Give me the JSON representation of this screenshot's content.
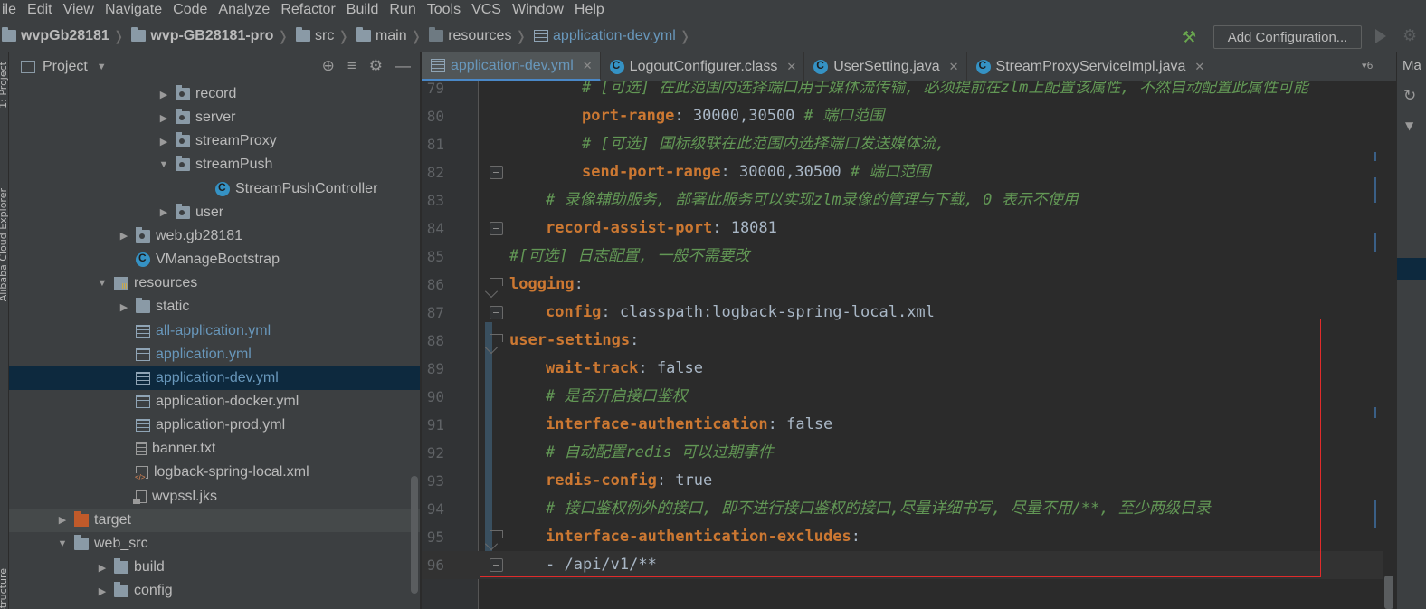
{
  "menu": [
    "ile",
    "Edit",
    "View",
    "Navigate",
    "Code",
    "Analyze",
    "Refactor",
    "Build",
    "Run",
    "Tools",
    "VCS",
    "Window",
    "Help"
  ],
  "breadcrumb": {
    "items": [
      {
        "label": "wvpGb28181",
        "bold": true,
        "icon": "folder-icon"
      },
      {
        "label": "wvp-GB28181-pro",
        "bold": true,
        "icon": "folder-icon"
      },
      {
        "label": "src",
        "bold": false,
        "icon": "folder-icon"
      },
      {
        "label": "main",
        "bold": false,
        "icon": "folder-icon"
      },
      {
        "label": "resources",
        "bold": false,
        "icon": "resources-folder-icon"
      },
      {
        "label": "application-dev.yml",
        "bold": false,
        "icon": "yml-file-icon"
      }
    ]
  },
  "toolbar": {
    "add_configuration_label": "Add Configuration...",
    "build_icon": "hammer-icon",
    "run_icon": "run-icon",
    "settings_icon": "gear-icon"
  },
  "left_stripe": {
    "tab_project": "1: Project",
    "tab_cloud": "Alibaba Cloud Explorer",
    "tab_structure": "Structure"
  },
  "project_panel": {
    "title": "Project",
    "tree": [
      {
        "label": "record",
        "depth": 3,
        "arrow": "right",
        "icon": "package-icon",
        "style": "plain"
      },
      {
        "label": "server",
        "depth": 3,
        "arrow": "right",
        "icon": "package-icon",
        "style": "plain"
      },
      {
        "label": "streamProxy",
        "depth": 3,
        "arrow": "right",
        "icon": "package-icon",
        "style": "plain"
      },
      {
        "label": "streamPush",
        "depth": 3,
        "arrow": "down",
        "icon": "package-icon",
        "style": "plain"
      },
      {
        "label": "StreamPushController",
        "depth": 4,
        "arrow": "",
        "icon": "class-icon",
        "style": "plain"
      },
      {
        "label": "user",
        "depth": 3,
        "arrow": "right",
        "icon": "package-icon",
        "style": "plain"
      },
      {
        "label": "web.gb28181",
        "depth": 2,
        "arrow": "right",
        "icon": "package-icon",
        "style": "plain"
      },
      {
        "label": "VManageBootstrap",
        "depth": 2,
        "arrow": "",
        "icon": "spring-boot-class-icon",
        "style": "plain"
      },
      {
        "label": "resources",
        "depth": 1,
        "arrow": "down",
        "icon": "resources-folder-icon",
        "style": "plain"
      },
      {
        "label": "static",
        "depth": 2,
        "arrow": "right",
        "icon": "folder-icon",
        "style": "plain"
      },
      {
        "label": "all-application.yml",
        "depth": 2,
        "arrow": "",
        "icon": "yml-file-icon",
        "style": "blue"
      },
      {
        "label": "application.yml",
        "depth": 2,
        "arrow": "",
        "icon": "yml-file-icon",
        "style": "blue"
      },
      {
        "label": "application-dev.yml",
        "depth": 2,
        "arrow": "",
        "icon": "yml-file-icon",
        "style": "blue",
        "selected": true
      },
      {
        "label": "application-docker.yml",
        "depth": 2,
        "arrow": "",
        "icon": "yml-file-icon",
        "style": "plain"
      },
      {
        "label": "application-prod.yml",
        "depth": 2,
        "arrow": "",
        "icon": "yml-file-icon",
        "style": "plain"
      },
      {
        "label": "banner.txt",
        "depth": 2,
        "arrow": "",
        "icon": "text-file-icon",
        "style": "plain"
      },
      {
        "label": "logback-spring-local.xml",
        "depth": 2,
        "arrow": "",
        "icon": "xml-file-icon",
        "style": "plain"
      },
      {
        "label": "wvpssl.jks",
        "depth": 2,
        "arrow": "",
        "icon": "keystore-file-icon",
        "style": "plain"
      },
      {
        "label": "target",
        "depth": 0,
        "arrow": "right",
        "icon": "target-folder-icon",
        "style": "plain",
        "hover": true
      },
      {
        "label": "web_src",
        "depth": 0,
        "arrow": "down",
        "icon": "folder-icon",
        "style": "plain"
      },
      {
        "label": "build",
        "depth": 1,
        "arrow": "right",
        "icon": "folder-icon",
        "style": "plain"
      },
      {
        "label": "config",
        "depth": 1,
        "arrow": "right",
        "icon": "folder-icon",
        "style": "plain"
      }
    ]
  },
  "tabs": [
    {
      "label": "application-dev.yml",
      "icon": "yml-file-icon",
      "active": true
    },
    {
      "label": "LogoutConfigurer.class",
      "icon": "class-file-icon",
      "active": false
    },
    {
      "label": "UserSetting.java",
      "icon": "class-icon",
      "active": false
    },
    {
      "label": "StreamProxyServiceImpl.java",
      "icon": "class-icon",
      "active": false
    }
  ],
  "tab_overflow_count": "6",
  "editor": {
    "lines": [
      {
        "n": "79",
        "indent": 4,
        "parts": [
          {
            "t": "# [可选] 在此范围内选择端口用于媒体流传输, 必须提前在zlm上配置该属性, 不然自动配置此属性可能",
            "c": "c"
          }
        ]
      },
      {
        "n": "80",
        "indent": 4,
        "parts": [
          {
            "t": "port-range",
            "c": "k"
          },
          {
            "t": ": 30000,30500 ",
            "c": "v"
          },
          {
            "t": "# 端口范围",
            "c": "c"
          }
        ]
      },
      {
        "n": "81",
        "indent": 4,
        "parts": [
          {
            "t": "# [可选] 国标级联在此范围内选择端口发送媒体流,",
            "c": "c"
          }
        ]
      },
      {
        "n": "82",
        "indent": 4,
        "parts": [
          {
            "t": "send-port-range",
            "c": "k"
          },
          {
            "t": ": 30000,30500 ",
            "c": "v"
          },
          {
            "t": "# 端口范围",
            "c": "c"
          }
        ],
        "fold": "end"
      },
      {
        "n": "83",
        "indent": 2,
        "parts": [
          {
            "t": "# 录像辅助服务, 部署此服务可以实现zlm录像的管理与下载, 0 表示不使用",
            "c": "c"
          }
        ]
      },
      {
        "n": "84",
        "indent": 2,
        "parts": [
          {
            "t": "record-assist-port",
            "c": "k"
          },
          {
            "t": ": 18081",
            "c": "v"
          }
        ],
        "fold": "end"
      },
      {
        "n": "85",
        "indent": 0,
        "parts": [
          {
            "t": "#[可选] 日志配置, 一般不需要改",
            "c": "c"
          }
        ]
      },
      {
        "n": "86",
        "indent": 0,
        "parts": [
          {
            "t": "logging",
            "c": "k"
          },
          {
            "t": ":",
            "c": "v"
          }
        ],
        "fold": "start"
      },
      {
        "n": "87",
        "indent": 2,
        "parts": [
          {
            "t": "config",
            "c": "k"
          },
          {
            "t": ": classpath:logback-spring-local.xml",
            "c": "v"
          }
        ],
        "fold": "end"
      },
      {
        "n": "88",
        "indent": 0,
        "parts": [
          {
            "t": "user-settings",
            "c": "k"
          },
          {
            "t": ":",
            "c": "v"
          }
        ],
        "fold": "start"
      },
      {
        "n": "89",
        "indent": 2,
        "parts": [
          {
            "t": "wait-track",
            "c": "k"
          },
          {
            "t": ": false",
            "c": "v"
          }
        ]
      },
      {
        "n": "90",
        "indent": 2,
        "parts": [
          {
            "t": "# 是否开启接口鉴权",
            "c": "c"
          }
        ]
      },
      {
        "n": "91",
        "indent": 2,
        "parts": [
          {
            "t": "interface-authentication",
            "c": "k"
          },
          {
            "t": ": false",
            "c": "v"
          }
        ]
      },
      {
        "n": "92",
        "indent": 2,
        "parts": [
          {
            "t": "# 自动配置redis 可以过期事件",
            "c": "c"
          }
        ]
      },
      {
        "n": "93",
        "indent": 2,
        "parts": [
          {
            "t": "redis-config",
            "c": "k"
          },
          {
            "t": ": true",
            "c": "v"
          }
        ]
      },
      {
        "n": "94",
        "indent": 2,
        "parts": [
          {
            "t": "# 接口鉴权例外的接口, 即不进行接口鉴权的接口,尽量详细书写, 尽量不用/**, 至少两级目录",
            "c": "c"
          }
        ]
      },
      {
        "n": "95",
        "indent": 2,
        "parts": [
          {
            "t": "interface-authentication-excludes",
            "c": "k"
          },
          {
            "t": ":",
            "c": "v"
          }
        ],
        "fold": "start"
      },
      {
        "n": "96",
        "indent": 2,
        "parts": [
          {
            "t": "- /api/v1/**",
            "c": "v"
          }
        ],
        "fold": "end",
        "current": true
      }
    ]
  },
  "right_panel": {
    "title": "Ma",
    "refresh_icon": "refresh-icon"
  }
}
